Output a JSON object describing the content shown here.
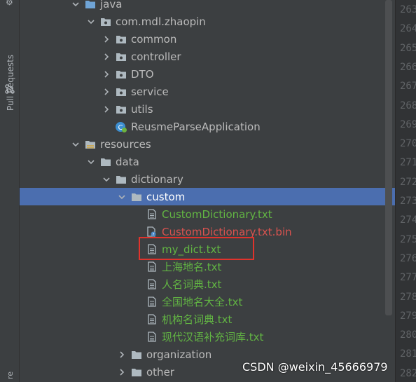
{
  "sidebar": {
    "pull_requests_label": "Pull Requests",
    "bottom_fragment": "re"
  },
  "tree": {
    "rows": [
      {
        "label": "java",
        "color": "normal",
        "icon": "folder-blue-icon",
        "arrow": "down",
        "indent": 0,
        "selected": false
      },
      {
        "label": "com.mdl.zhaopin",
        "color": "normal",
        "icon": "package-icon",
        "arrow": "down",
        "indent": 1,
        "selected": false
      },
      {
        "label": "common",
        "color": "normal",
        "icon": "package-icon",
        "arrow": "right",
        "indent": 2,
        "selected": false
      },
      {
        "label": "controller",
        "color": "normal",
        "icon": "package-icon",
        "arrow": "right",
        "indent": 2,
        "selected": false
      },
      {
        "label": "DTO",
        "color": "normal",
        "icon": "package-icon",
        "arrow": "right",
        "indent": 2,
        "selected": false
      },
      {
        "label": "service",
        "color": "normal",
        "icon": "package-icon",
        "arrow": "right",
        "indent": 2,
        "selected": false
      },
      {
        "label": "utils",
        "color": "normal",
        "icon": "package-icon",
        "arrow": "right",
        "indent": 2,
        "selected": false
      },
      {
        "label": "ReusmeParseApplication",
        "color": "normal",
        "icon": "spring-boot-class-icon",
        "arrow": "none",
        "indent": 2,
        "selected": false
      },
      {
        "label": "resources",
        "color": "normal",
        "icon": "resources-folder-icon",
        "arrow": "down",
        "indent": 0,
        "selected": false
      },
      {
        "label": "data",
        "color": "normal",
        "icon": "folder-icon",
        "arrow": "down",
        "indent": 1,
        "selected": false
      },
      {
        "label": "dictionary",
        "color": "normal",
        "icon": "folder-icon",
        "arrow": "down",
        "indent": 2,
        "selected": false
      },
      {
        "label": "custom",
        "color": "normal",
        "icon": "folder-icon",
        "arrow": "down",
        "indent": 3,
        "selected": true
      },
      {
        "label": "CustomDictionary.txt",
        "color": "green",
        "icon": "text-file-icon",
        "arrow": "none",
        "indent": 4,
        "selected": false
      },
      {
        "label": "CustomDictionary.txt.bin",
        "color": "red",
        "icon": "unknown-file-icon",
        "arrow": "none",
        "indent": 4,
        "selected": false
      },
      {
        "label": "my_dict.txt",
        "color": "green",
        "icon": "text-file-icon",
        "arrow": "none",
        "indent": 4,
        "selected": false
      },
      {
        "label": "上海地名.txt",
        "color": "green",
        "icon": "text-file-icon",
        "arrow": "none",
        "indent": 4,
        "selected": false
      },
      {
        "label": "人名词典.txt",
        "color": "green",
        "icon": "text-file-icon",
        "arrow": "none",
        "indent": 4,
        "selected": false
      },
      {
        "label": "全国地名大全.txt",
        "color": "green",
        "icon": "text-file-icon",
        "arrow": "none",
        "indent": 4,
        "selected": false
      },
      {
        "label": "机构名词典.txt",
        "color": "green",
        "icon": "text-file-icon",
        "arrow": "none",
        "indent": 4,
        "selected": false
      },
      {
        "label": "现代汉语补充词库.txt",
        "color": "green",
        "icon": "text-file-icon",
        "arrow": "none",
        "indent": 4,
        "selected": false
      },
      {
        "label": "organization",
        "color": "normal",
        "icon": "folder-icon",
        "arrow": "right",
        "indent": 3,
        "selected": false
      },
      {
        "label": "other",
        "color": "normal",
        "icon": "folder-icon",
        "arrow": "right",
        "indent": 3,
        "selected": false
      }
    ]
  },
  "gutter": {
    "line_numbers": [
      "263",
      "264",
      "265",
      "266",
      "267",
      "268",
      "269",
      "270",
      "271",
      "272",
      "273",
      "274",
      "275",
      "276",
      "277",
      "278",
      "279",
      "280",
      "281",
      "282"
    ]
  },
  "watermark": "CSDN @weixin_45666979",
  "colors": {
    "selection": "#4b6eaf",
    "text": "#bbbbbb",
    "added_file": "#62b543",
    "ignored_file": "#d9534f",
    "highlight_box": "#e0332c"
  }
}
